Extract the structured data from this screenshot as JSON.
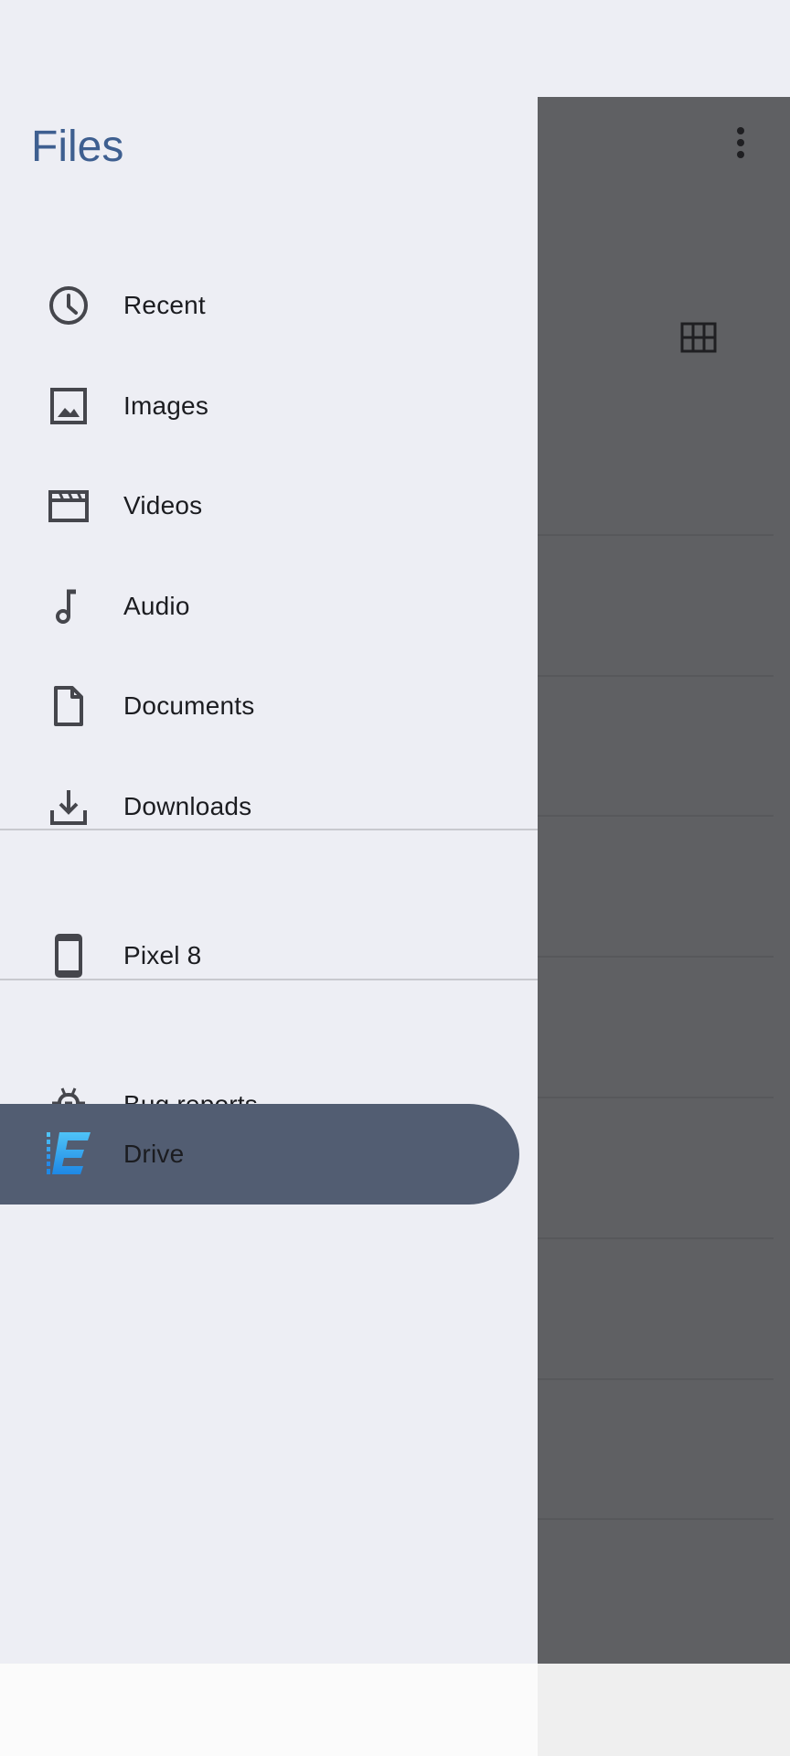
{
  "drawer": {
    "title": "Files",
    "items": [
      {
        "label": "Recent",
        "icon": "clock-icon"
      },
      {
        "label": "Images",
        "icon": "image-icon"
      },
      {
        "label": "Videos",
        "icon": "video-icon"
      },
      {
        "label": "Audio",
        "icon": "music-note-icon"
      },
      {
        "label": "Documents",
        "icon": "document-icon"
      },
      {
        "label": "Downloads",
        "icon": "download-icon"
      }
    ],
    "devices": [
      {
        "label": "Pixel 8",
        "icon": "phone-icon"
      }
    ],
    "apps": [
      {
        "label": "Bug reports",
        "icon": "bug-icon"
      },
      {
        "label": "Drive",
        "icon": "drive-app-icon",
        "selected": true
      }
    ]
  },
  "background": {
    "more_icon": "more-vert-icon",
    "view_icon": "grid-view-icon"
  },
  "colors": {
    "accent": "#3e5f90",
    "selected_bg": "#525d72",
    "scrim": "#5f6063",
    "drawer_bg": "#edeef4"
  }
}
